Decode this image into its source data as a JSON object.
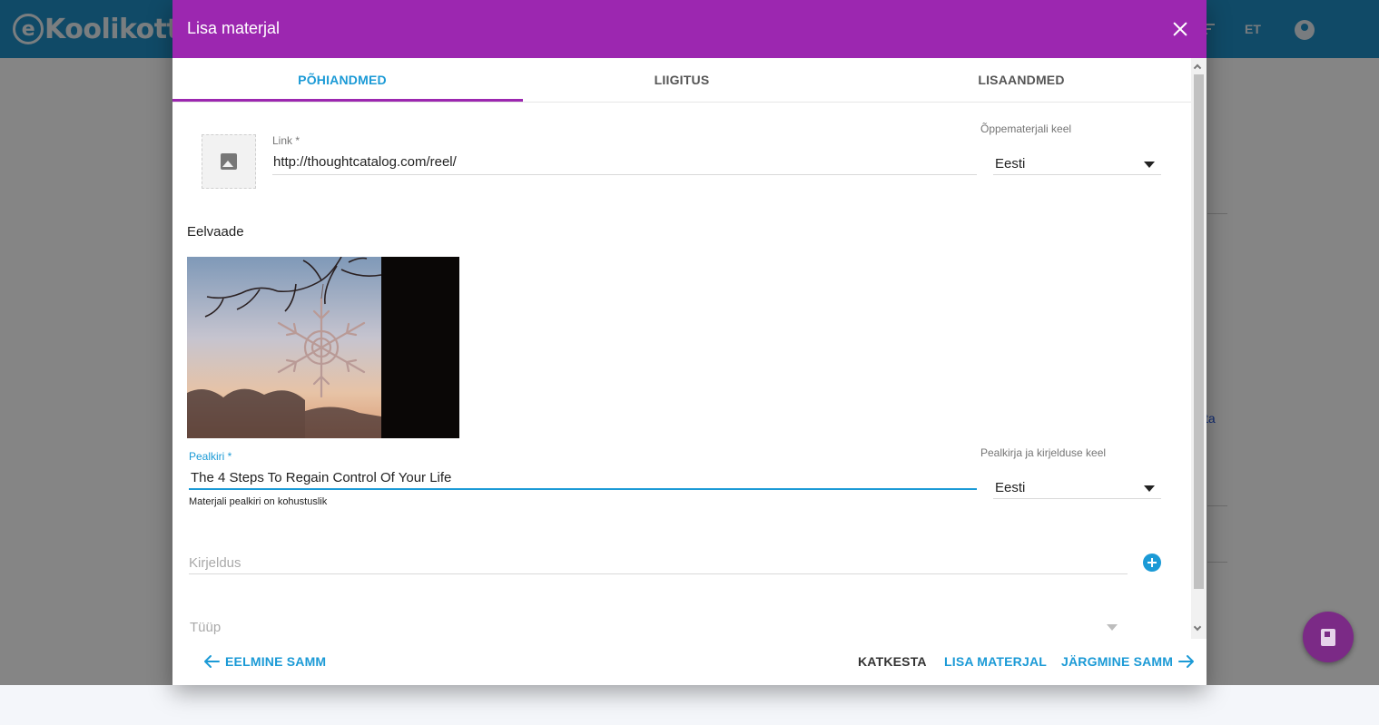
{
  "app": {
    "logo_text": "Koolikott",
    "logo_e": "e",
    "language": "ET",
    "background_link": "ta"
  },
  "dialog": {
    "title": "Lisa materjal",
    "tabs": [
      {
        "label": "PÕHIANDMED",
        "active": true
      },
      {
        "label": "LIIGITUS",
        "active": false
      },
      {
        "label": "LISAANDMED",
        "active": false
      }
    ]
  },
  "form": {
    "link": {
      "label": "Link *",
      "value": "http://thoughtcatalog.com/reel/"
    },
    "material_language": {
      "label": "Õppematerjali keel",
      "value": "Eesti"
    },
    "preview": {
      "title": "Eelvaade"
    },
    "title": {
      "label": "Pealkiri *",
      "value": "The 4 Steps To Regain Control Of Your Life",
      "hint": "Materjali pealkiri on kohustuslik"
    },
    "title_language": {
      "label": "Pealkirja ja kirjelduse keel",
      "value": "Eesti"
    },
    "description": {
      "placeholder": "Kirjeldus"
    },
    "type": {
      "placeholder": "Tüüp"
    }
  },
  "footer": {
    "prev": "EELMINE SAMM",
    "cancel": "KATKESTA",
    "add": "LISA MATERJAL",
    "next": "JÄRGMINE SAMM"
  },
  "colors": {
    "header": "#9c27b0",
    "accent": "#1b9ad6",
    "app_header": "#1f8fc6",
    "fab": "#7b2a86"
  }
}
